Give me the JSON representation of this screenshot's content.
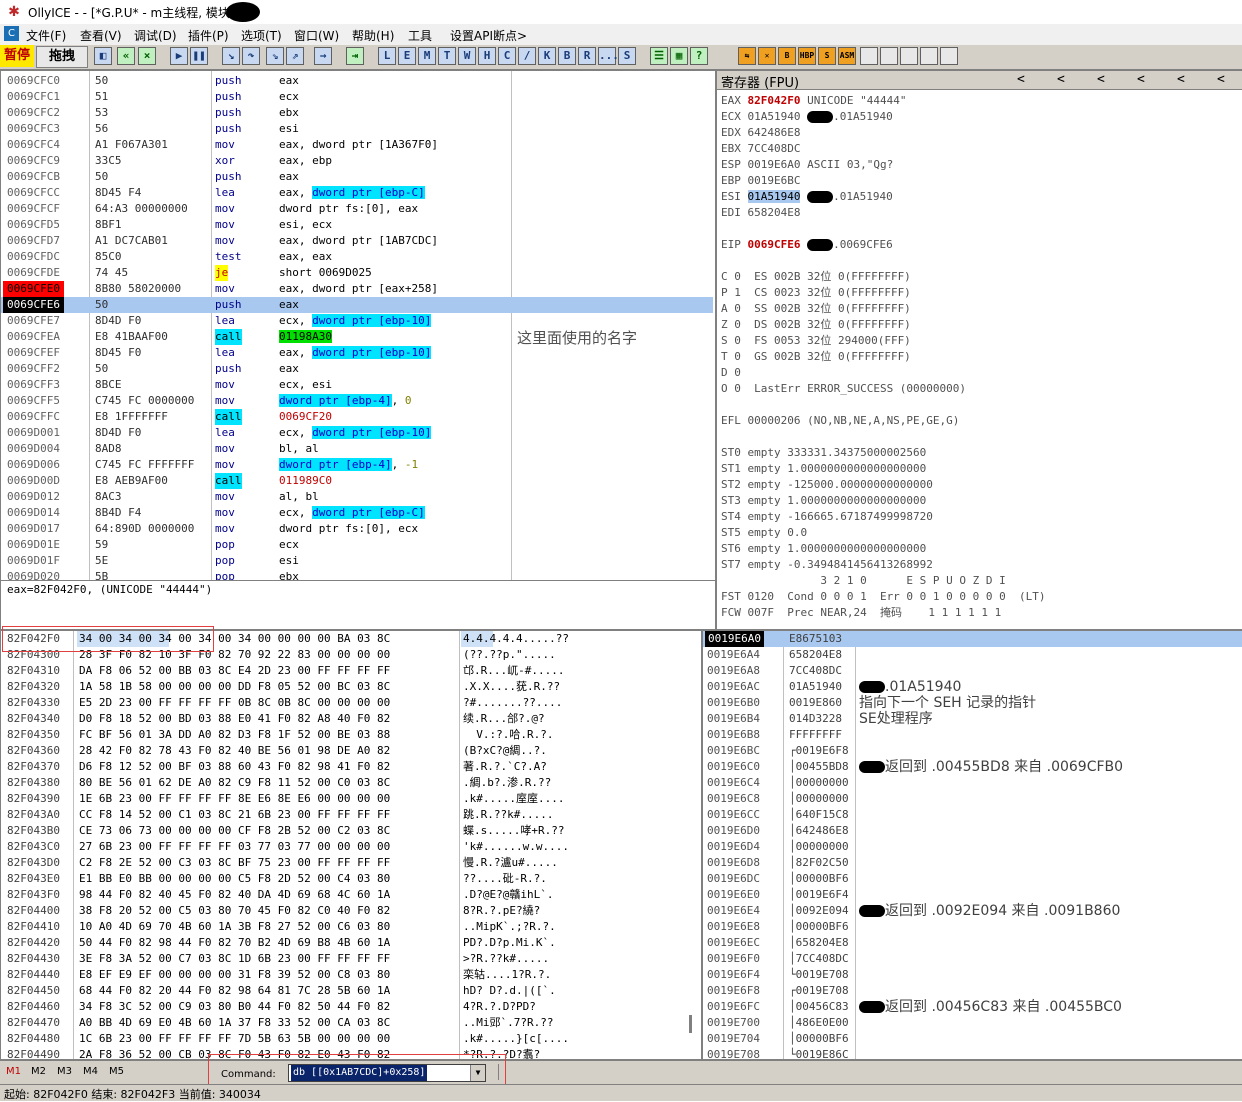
{
  "window": {
    "app_icon": "ollydbg-bug-icon",
    "title": "OllyICE - - [*G.P.U* - m主线程, 模块 -"
  },
  "menu": [
    "文件(F)",
    "查看(V)",
    "调试(D)",
    "插件(P)",
    "选项(T)",
    "窗口(W)",
    "帮助(H)",
    "工具",
    "设置API断点>"
  ],
  "toolbar": {
    "pause_label": "暂停",
    "status_label": "拖拽",
    "letters": [
      "L",
      "E",
      "M",
      "T",
      "W",
      "H",
      "C",
      "/",
      "K",
      "B",
      "R",
      "...",
      "S"
    ],
    "plugins": [
      "HBP",
      "ASM"
    ]
  },
  "disasm": [
    {
      "addr": "0069CFC0",
      "hex": "50",
      "mn": "push",
      "op": "eax"
    },
    {
      "addr": "0069CFC1",
      "hex": "51",
      "mn": "push",
      "op": "ecx"
    },
    {
      "addr": "0069CFC2",
      "hex": "53",
      "mn": "push",
      "op": "ebx"
    },
    {
      "addr": "0069CFC3",
      "hex": "56",
      "mn": "push",
      "op": "esi"
    },
    {
      "addr": "0069CFC4",
      "hex": "A1 F067A301",
      "mn": "mov",
      "op": "eax, dword ptr [1A367F0]"
    },
    {
      "addr": "0069CFC9",
      "hex": "33C5",
      "mn": "xor",
      "op": "eax, ebp"
    },
    {
      "addr": "0069CFCB",
      "hex": "50",
      "mn": "push",
      "op": "eax"
    },
    {
      "addr": "0069CFCC",
      "hex": "8D45 F4",
      "mn": "lea",
      "op_pre": "eax, ",
      "op_hl": "dword ptr [ebp-C]"
    },
    {
      "addr": "0069CFCF",
      "hex": "64:A3 00000000",
      "mn": "mov",
      "op": "dword ptr fs:[0], eax"
    },
    {
      "addr": "0069CFD5",
      "hex": "8BF1",
      "mn": "mov",
      "op": "esi, ecx"
    },
    {
      "addr": "0069CFD7",
      "hex": "A1 DC7CAB01",
      "mn": "mov",
      "op": "eax, dword ptr [1AB7CDC]"
    },
    {
      "addr": "0069CFDC",
      "hex": "85C0",
      "mn": "test",
      "op": "eax, eax"
    },
    {
      "addr": "0069CFDE",
      "hex": "74 45",
      "mn": "je",
      "op": "short 0069D025",
      "kind": "jcc"
    },
    {
      "addr": "0069CFE0",
      "hex": "8B80 58020000",
      "mn": "mov",
      "op": "eax, dword ptr [eax+258]",
      "addrkind": "bp"
    },
    {
      "addr": "0069CFE6",
      "hex": "50",
      "mn": "push",
      "op": "eax",
      "addrkind": "cur",
      "sel": true
    },
    {
      "addr": "0069CFE7",
      "hex": "8D4D F0",
      "mn": "lea",
      "op_pre": "ecx, ",
      "op_hl": "dword ptr [ebp-10]"
    },
    {
      "addr": "0069CFEA",
      "hex": "E8 41BAAF00",
      "mn": "call",
      "op_green": "01198A30",
      "kind": "call"
    },
    {
      "addr": "0069CFEF",
      "hex": "8D45 F0",
      "mn": "lea",
      "op_pre": "eax, ",
      "op_hl": "dword ptr [ebp-10]"
    },
    {
      "addr": "0069CFF2",
      "hex": "50",
      "mn": "push",
      "op": "eax"
    },
    {
      "addr": "0069CFF3",
      "hex": "8BCE",
      "mn": "mov",
      "op": "ecx, esi"
    },
    {
      "addr": "0069CFF5",
      "hex": "C745 FC 0000000",
      "mn": "mov",
      "op_hl": "dword ptr [ebp-4]",
      "op_post": ", ",
      "op_num": "0"
    },
    {
      "addr": "0069CFFC",
      "hex": "E8 1FFFFFFF",
      "mn": "call",
      "op": "0069CF20",
      "kind": "call",
      "opred": true
    },
    {
      "addr": "0069D001",
      "hex": "8D4D F0",
      "mn": "lea",
      "op_pre": "ecx, ",
      "op_hl": "dword ptr [ebp-10]"
    },
    {
      "addr": "0069D004",
      "hex": "8AD8",
      "mn": "mov",
      "op": "bl, al"
    },
    {
      "addr": "0069D006",
      "hex": "C745 FC FFFFFFF",
      "mn": "mov",
      "op_hl": "dword ptr [ebp-4]",
      "op_post": ", ",
      "op_num": "-1"
    },
    {
      "addr": "0069D00D",
      "hex": "E8 AEB9AF00",
      "mn": "call",
      "op": "011989C0",
      "kind": "call",
      "opred": true
    },
    {
      "addr": "0069D012",
      "hex": "8AC3",
      "mn": "mov",
      "op": "al, bl"
    },
    {
      "addr": "0069D014",
      "hex": "8B4D F4",
      "mn": "mov",
      "op_pre": "ecx, ",
      "op_hl": "dword ptr [ebp-C]"
    },
    {
      "addr": "0069D017",
      "hex": "64:890D 0000000",
      "mn": "mov",
      "op": "dword ptr fs:[0], ecx"
    },
    {
      "addr": "0069D01E",
      "hex": "59",
      "mn": "pop",
      "op": "ecx"
    },
    {
      "addr": "0069D01F",
      "hex": "5E",
      "mn": "pop",
      "op": "esi"
    },
    {
      "addr": "0069D020",
      "hex": "5B",
      "mn": "pop",
      "op": "ebx"
    }
  ],
  "disasm_note": "这里面使用的名字",
  "info_line": "eax=82F042F0, (UNICODE \"44444\")",
  "registers": {
    "header": "寄存器 (FPU)",
    "lines": [
      {
        "t": "EAX ",
        "v": "82F042F0",
        "red": true,
        "r": " UNICODE \"44444\""
      },
      {
        "t": "ECX 01A51940 ",
        "blob": true,
        "r": ".01A51940"
      },
      {
        "t": "EDX 642486E8"
      },
      {
        "t": "EBX 7CC408DC"
      },
      {
        "t": "ESP 0019E6A0 ASCII 03,\"Qg?"
      },
      {
        "t": "EBP 0019E6BC"
      },
      {
        "t": "ESI ",
        "v": "01A51940",
        "sel": true,
        "blob": true,
        "r": ".01A51940"
      },
      {
        "t": "EDI 658204E8"
      },
      {
        "t": ""
      },
      {
        "t": "EIP ",
        "v": "0069CFE6",
        "red": true,
        "blob": true,
        "r": ".0069CFE6"
      },
      {
        "t": ""
      },
      {
        "t": "C 0  ES 002B 32位 0(FFFFFFFF)"
      },
      {
        "t": "P 1  CS 0023 32位 0(FFFFFFFF)"
      },
      {
        "t": "A 0  SS 002B 32位 0(FFFFFFFF)"
      },
      {
        "t": "Z 0  DS 002B 32位 0(FFFFFFFF)"
      },
      {
        "t": "S 0  FS 0053 32位 294000(FFF)"
      },
      {
        "t": "T 0  GS 002B 32位 0(FFFFFFFF)"
      },
      {
        "t": "D 0"
      },
      {
        "t": "O 0  LastErr ERROR_SUCCESS (00000000)"
      },
      {
        "t": ""
      },
      {
        "t": "EFL 00000206 (NO,NB,NE,A,NS,PE,GE,G)"
      },
      {
        "t": ""
      },
      {
        "t": "ST0 empty 333331.34375000002560"
      },
      {
        "t": "ST1 empty 1.0000000000000000000"
      },
      {
        "t": "ST2 empty -125000.00000000000000"
      },
      {
        "t": "ST3 empty 1.0000000000000000000"
      },
      {
        "t": "ST4 empty -166665.67187499998720"
      },
      {
        "t": "ST5 empty 0.0"
      },
      {
        "t": "ST6 empty 1.0000000000000000000"
      },
      {
        "t": "ST7 empty -0.3494841456413268992"
      },
      {
        "t": "               3 2 1 0      E S P U O Z D I"
      },
      {
        "t": "FST 0120  Cond 0 0 0 1  Err 0 0 1 0 0 0 0 0  (LT)"
      },
      {
        "t": "FCW 007F  Prec NEAR,24  掩码    1 1 1 1 1 1"
      }
    ]
  },
  "dump": [
    {
      "a": "82F042F0",
      "h": "34 00 34 00 34 00 34 00 34 00 00 00 00 BA 03 8C",
      "s": "4.4.4.4.4.....??"
    },
    {
      "a": "82F04300",
      "h": "28 3F F0 82 10 3F F0 82 70 92 22 83 00 00 00 00",
      "s": "(??.??p.\"....."
    },
    {
      "a": "82F04310",
      "h": "DA F8 06 52 00 BB 03 8C E4 2D 23 00 FF FF FF FF",
      "s": "邙.R...屼-#....."
    },
    {
      "a": "82F04320",
      "h": "1A 58 1B 58 00 00 00 00 DD F8 05 52 00 BC 03 8C",
      "s": ".X.X....莸.R.??"
    },
    {
      "a": "82F04330",
      "h": "E5 2D 23 00 FF FF FF FF 0B 8C 0B 8C 00 00 00 00",
      "s": "?#.......??...."
    },
    {
      "a": "82F04340",
      "h": "D0 F8 18 52 00 BD 03 88 E0 41 F0 82 A8 40 F0 82",
      "s": "续.R...郃?.@?"
    },
    {
      "a": "82F04350",
      "h": "FC BF 56 01 3A DD A0 82 D3 F8 1F 52 00 BE 03 88",
      "s": "  V.:?.哈.R.?."
    },
    {
      "a": "82F04360",
      "h": "28 42 F0 82 78 43 F0 82 40 BE 56 01 98 DE A0 82",
      "s": "(B?xC?@綢..?."
    },
    {
      "a": "82F04370",
      "h": "D6 F8 12 52 00 BF 03 88 60 43 F0 82 98 41 F0 82",
      "s": "著.R.?.`C?.A?"
    },
    {
      "a": "82F04380",
      "h": "80 BE 56 01 62 DE A0 82 C9 F8 11 52 00 C0 03 8C",
      "s": ".綢.b?.渗.R.??"
    },
    {
      "a": "82F04390",
      "h": "1E 6B 23 00 FF FF FF FF 8E E6 8E E6 00 00 00 00",
      "s": ".k#.....庢庢...."
    },
    {
      "a": "82F043A0",
      "h": "CC F8 14 52 00 C1 03 8C 21 6B 23 00 FF FF FF FF",
      "s": "跳.R.??k#....."
    },
    {
      "a": "82F043B0",
      "h": "CE 73 06 73 00 00 00 00 CF F8 2B 52 00 C2 03 8C",
      "s": "蝶.s.....哮+R.??"
    },
    {
      "a": "82F043C0",
      "h": "27 6B 23 00 FF FF FF FF 03 77 03 77 00 00 00 00",
      "s": "'k#......w.w...."
    },
    {
      "a": "82F043D0",
      "h": "C2 F8 2E 52 00 C3 03 8C BF 75 23 00 FF FF FF FF",
      "s": "慢.R.?瀘u#....."
    },
    {
      "a": "82F043E0",
      "h": "E1 BB E0 BB 00 00 00 00 C5 F8 2D 52 00 C4 03 80",
      "s": "??....砒-R.?."
    },
    {
      "a": "82F043F0",
      "h": "98 44 F0 82 40 45 F0 82 40 DA 4D 69 68 4C 60 1A",
      "s": ".D?@E?@贛ihL`."
    },
    {
      "a": "82F04400",
      "h": "38 F8 20 52 00 C5 03 80 70 45 F0 82 C0 40 F0 82",
      "s": "8?R.?.pE?繞?"
    },
    {
      "a": "82F04410",
      "h": "10 A0 4D 69 70 4B 60 1A 3B F8 27 52 00 C6 03 80",
      "s": "..MipK`.;?R.?."
    },
    {
      "a": "82F04420",
      "h": "50 44 F0 82 98 44 F0 82 70 B2 4D 69 B8 4B 60 1A",
      "s": "PD?.D?p.Mi.K`."
    },
    {
      "a": "82F04430",
      "h": "3E F8 3A 52 00 C7 03 8C 1D 6B 23 00 FF FF FF FF",
      "s": ">?R.??k#....."
    },
    {
      "a": "82F04440",
      "h": "E8 EF E9 EF 00 00 00 00 31 F8 39 52 00 C8 03 80",
      "s": "栾轱....1?R.?."
    },
    {
      "a": "82F04450",
      "h": "68 44 F0 82 20 44 F0 82 98 64 81 7C 28 5B 60 1A",
      "s": "hD? D?.d.|([`."
    },
    {
      "a": "82F04460",
      "h": "34 F8 3C 52 00 C9 03 80 B0 44 F0 82 50 44 F0 82",
      "s": "4?R.?.D?PD?"
    },
    {
      "a": "82F04470",
      "h": "A0 BB 4D 69 E0 4B 60 1A 37 F8 33 52 00 CA 03 8C",
      "s": "..Mi郖`.7?R.??"
    },
    {
      "a": "82F04480",
      "h": "1C 6B 23 00 FF FF FF FF 7D 5B 63 5B 00 00 00 00",
      "s": ".k#.....}[c[...."
    },
    {
      "a": "82F04490",
      "h": "2A F8 36 52 00 CB 03 8C F0 43 F0 82 E0 43 F0 82",
      "s": "*?R.?.?D?翥?"
    }
  ],
  "stack": [
    {
      "a": "0019E6A0",
      "v": "E8675103",
      "c": "",
      "cur": true
    },
    {
      "a": "0019E6A4",
      "v": "658204E8",
      "c": ""
    },
    {
      "a": "0019E6A8",
      "v": "7CC408DC",
      "c": ""
    },
    {
      "a": "0019E6AC",
      "v": "01A51940",
      "c": ".01A51940",
      "blob": true
    },
    {
      "a": "0019E6B0",
      "v": "0019E860",
      "c": "指向下一个 SEH 记录的指针"
    },
    {
      "a": "0019E6B4",
      "v": "014D3228",
      "c": "SE处理程序"
    },
    {
      "a": "0019E6B8",
      "v": "FFFFFFFF",
      "c": ""
    },
    {
      "a": "0019E6BC",
      "v": "┌0019E6F8",
      "c": ""
    },
    {
      "a": "0019E6C0",
      "v": "│00455BD8",
      "c": "返回到 .00455BD8 来自 .0069CFB0",
      "blob": true
    },
    {
      "a": "0019E6C4",
      "v": "│00000000",
      "c": ""
    },
    {
      "a": "0019E6C8",
      "v": "│00000000",
      "c": ""
    },
    {
      "a": "0019E6CC",
      "v": "│640F15C8",
      "c": ""
    },
    {
      "a": "0019E6D0",
      "v": "│642486E8",
      "c": ""
    },
    {
      "a": "0019E6D4",
      "v": "│00000000",
      "c": ""
    },
    {
      "a": "0019E6D8",
      "v": "│82F02C50",
      "c": ""
    },
    {
      "a": "0019E6DC",
      "v": "│00000BF6",
      "c": ""
    },
    {
      "a": "0019E6E0",
      "v": "│0019E6F4",
      "c": ""
    },
    {
      "a": "0019E6E4",
      "v": "│0092E094",
      "c": "返回到 .0092E094 来自 .0091B860",
      "blob": true
    },
    {
      "a": "0019E6E8",
      "v": "│00000BF6",
      "c": ""
    },
    {
      "a": "0019E6EC",
      "v": "│658204E8",
      "c": ""
    },
    {
      "a": "0019E6F0",
      "v": "│7CC408DC",
      "c": ""
    },
    {
      "a": "0019E6F4",
      "v": "└0019E708",
      "c": ""
    },
    {
      "a": "0019E6F8",
      "v": "┌0019E708",
      "c": ""
    },
    {
      "a": "0019E6FC",
      "v": "│00456C83",
      "c": "返回到 .00456C83 来自 .00455BC0",
      "blob": true
    },
    {
      "a": "0019E700",
      "v": "│486E0E00",
      "c": ""
    },
    {
      "a": "0019E704",
      "v": "│00000BF6",
      "c": ""
    },
    {
      "a": "0019E708",
      "v": "└0019E86C",
      "c": ""
    }
  ],
  "cmdbar": {
    "tabs": [
      "M1",
      "M2",
      "M3",
      "M4",
      "M5"
    ],
    "label": "Command:",
    "value": "db [[0x1AB7CDC]+0x258]"
  },
  "status": "起始: 82F042F0 结束: 82F042F3 当前值: 340034"
}
